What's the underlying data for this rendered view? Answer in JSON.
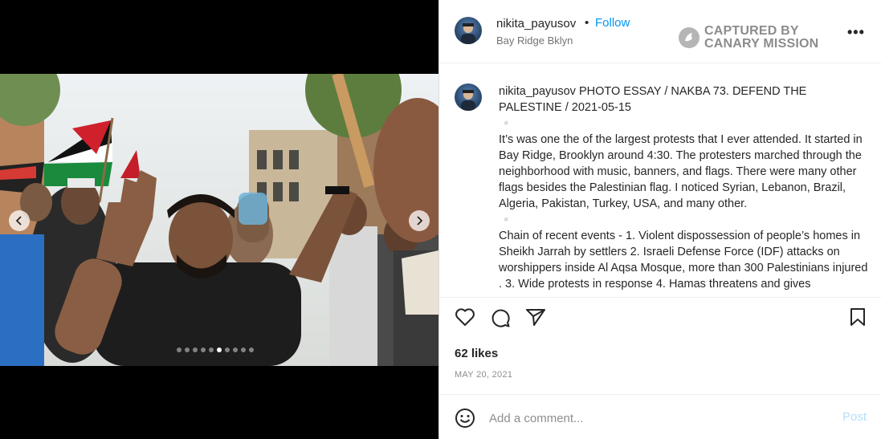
{
  "post": {
    "username": "nikita_payusov",
    "bullet": "•",
    "follow_label": "Follow",
    "location": "Bay Ridge Bklyn",
    "more_label": "•••"
  },
  "watermark": {
    "line1": "CAPTURED BY",
    "line2": "CANARY MISSION"
  },
  "caption": {
    "username": "nikita_payusov",
    "lines": [
      "PHOTO ESSAY / NAKBA 73. DEFEND THE PALESTINE / 2021-05-15",
      "▫️",
      "It’s was one the of the largest protests that I ever attended. It started in Bay Ridge, Brooklyn around 4:30. The protesters marched through the neighborhood with music, banners, and flags. There were many other flags besides the Palestinian flag. I noticed Syrian, Lebanon, Brazil, Algeria, Pakistan, Turkey, USA, and many other.",
      "▫️",
      "Chain of recent events - 1. Violent dispossession of people’s homes in Sheikh Jarrah by settlers 2. Israeli Defense Force (IDF) attacks on worshippers inside Al Aqsa Mosque, more than 300 Palestinians injured . 3. Wide protests in response 4. Hamas threatens and gives"
    ]
  },
  "carousel": {
    "slide_count": 10,
    "active_index": 5
  },
  "stats": {
    "likes": "62 likes",
    "date": "MAY 20, 2021"
  },
  "comment": {
    "placeholder": "Add a comment...",
    "post_label": "Post"
  },
  "icons": {
    "like": "heart-icon",
    "comment": "comment-bubble-icon",
    "share": "paper-plane-icon",
    "save": "bookmark-icon",
    "emoji": "smiley-icon",
    "prev": "chevron-left-icon",
    "next": "chevron-right-icon"
  },
  "colors": {
    "follow": "#0095f6",
    "post_disabled": "#b2dffc",
    "muted_text": "#8e8e8e"
  }
}
